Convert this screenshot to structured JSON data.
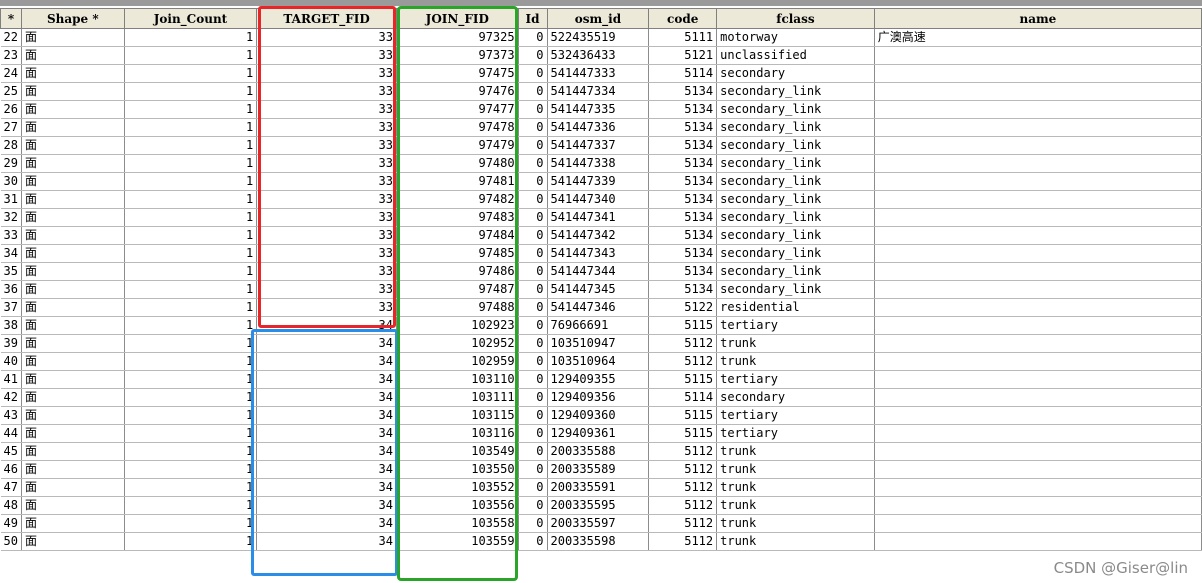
{
  "table": {
    "headers": [
      "*",
      "Shape *",
      "Join_Count",
      "TARGET_FID",
      "JOIN_FID",
      "Id",
      "osm_id",
      "code",
      "fclass",
      "name"
    ],
    "rows": [
      [
        "22",
        "面",
        "1",
        "33",
        "97325",
        "0",
        "522435519",
        "5111",
        "motorway",
        "广澳高速"
      ],
      [
        "23",
        "面",
        "1",
        "33",
        "97373",
        "0",
        "532436433",
        "5121",
        "unclassified",
        ""
      ],
      [
        "24",
        "面",
        "1",
        "33",
        "97475",
        "0",
        "541447333",
        "5114",
        "secondary",
        ""
      ],
      [
        "25",
        "面",
        "1",
        "33",
        "97476",
        "0",
        "541447334",
        "5134",
        "secondary_link",
        ""
      ],
      [
        "26",
        "面",
        "1",
        "33",
        "97477",
        "0",
        "541447335",
        "5134",
        "secondary_link",
        ""
      ],
      [
        "27",
        "面",
        "1",
        "33",
        "97478",
        "0",
        "541447336",
        "5134",
        "secondary_link",
        ""
      ],
      [
        "28",
        "面",
        "1",
        "33",
        "97479",
        "0",
        "541447337",
        "5134",
        "secondary_link",
        ""
      ],
      [
        "29",
        "面",
        "1",
        "33",
        "97480",
        "0",
        "541447338",
        "5134",
        "secondary_link",
        ""
      ],
      [
        "30",
        "面",
        "1",
        "33",
        "97481",
        "0",
        "541447339",
        "5134",
        "secondary_link",
        ""
      ],
      [
        "31",
        "面",
        "1",
        "33",
        "97482",
        "0",
        "541447340",
        "5134",
        "secondary_link",
        ""
      ],
      [
        "32",
        "面",
        "1",
        "33",
        "97483",
        "0",
        "541447341",
        "5134",
        "secondary_link",
        ""
      ],
      [
        "33",
        "面",
        "1",
        "33",
        "97484",
        "0",
        "541447342",
        "5134",
        "secondary_link",
        ""
      ],
      [
        "34",
        "面",
        "1",
        "33",
        "97485",
        "0",
        "541447343",
        "5134",
        "secondary_link",
        ""
      ],
      [
        "35",
        "面",
        "1",
        "33",
        "97486",
        "0",
        "541447344",
        "5134",
        "secondary_link",
        ""
      ],
      [
        "36",
        "面",
        "1",
        "33",
        "97487",
        "0",
        "541447345",
        "5134",
        "secondary_link",
        ""
      ],
      [
        "37",
        "面",
        "1",
        "33",
        "97488",
        "0",
        "541447346",
        "5122",
        "residential",
        ""
      ],
      [
        "38",
        "面",
        "1",
        "34",
        "102923",
        "0",
        "76966691",
        "5115",
        "tertiary",
        ""
      ],
      [
        "39",
        "面",
        "1",
        "34",
        "102952",
        "0",
        "103510947",
        "5112",
        "trunk",
        ""
      ],
      [
        "40",
        "面",
        "1",
        "34",
        "102959",
        "0",
        "103510964",
        "5112",
        "trunk",
        ""
      ],
      [
        "41",
        "面",
        "1",
        "34",
        "103110",
        "0",
        "129409355",
        "5115",
        "tertiary",
        ""
      ],
      [
        "42",
        "面",
        "1",
        "34",
        "103111",
        "0",
        "129409356",
        "5114",
        "secondary",
        ""
      ],
      [
        "43",
        "面",
        "1",
        "34",
        "103115",
        "0",
        "129409360",
        "5115",
        "tertiary",
        ""
      ],
      [
        "44",
        "面",
        "1",
        "34",
        "103116",
        "0",
        "129409361",
        "5115",
        "tertiary",
        ""
      ],
      [
        "45",
        "面",
        "1",
        "34",
        "103549",
        "0",
        "200335588",
        "5112",
        "trunk",
        ""
      ],
      [
        "46",
        "面",
        "1",
        "34",
        "103550",
        "0",
        "200335589",
        "5112",
        "trunk",
        ""
      ],
      [
        "47",
        "面",
        "1",
        "34",
        "103552",
        "0",
        "200335591",
        "5112",
        "trunk",
        ""
      ],
      [
        "48",
        "面",
        "1",
        "34",
        "103556",
        "0",
        "200335595",
        "5112",
        "trunk",
        ""
      ],
      [
        "49",
        "面",
        "1",
        "34",
        "103558",
        "0",
        "200335597",
        "5112",
        "trunk",
        ""
      ],
      [
        "50",
        "面",
        "1",
        "34",
        "103559",
        "0",
        "200335598",
        "5112",
        "trunk",
        ""
      ]
    ]
  },
  "annotations": {
    "red_color": "#e8262a",
    "blue_color": "#2a8de8",
    "green_color": "#2aa52a"
  },
  "watermark": "CSDN @Giser@lin"
}
